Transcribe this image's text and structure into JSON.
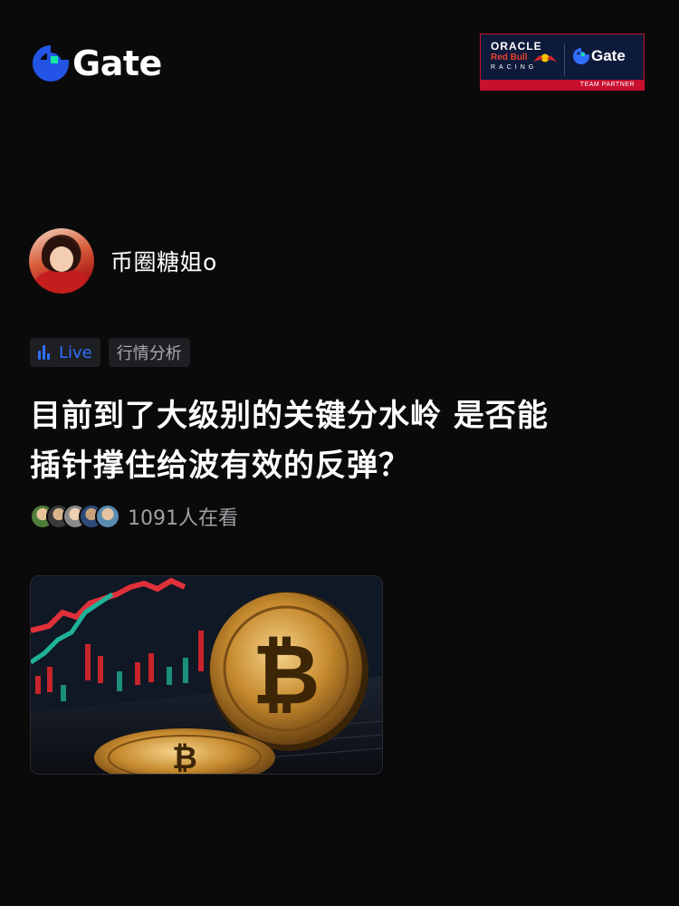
{
  "header": {
    "logo_text": "Gate",
    "partner": {
      "oracle": "ORACLE",
      "redbull": "Red Bull",
      "racing": "RACING",
      "gate": "Gate",
      "footer": "TEAM PARTNER"
    }
  },
  "author": {
    "name": "币圈糖姐o"
  },
  "tags": {
    "live": "Live",
    "topic": "行情分析"
  },
  "post": {
    "title_line1": "目前到了大级别的关键分水岭 是否能",
    "title_line2": "插针撑住给波有效的反弹？"
  },
  "viewers": {
    "count_text": "1091人在看"
  },
  "colors": {
    "background": "#0a0a0b",
    "brand_blue": "#2354e6",
    "brand_green": "#17e6a1",
    "live_blue": "#2f6fff",
    "partner_red": "#c8102e"
  }
}
